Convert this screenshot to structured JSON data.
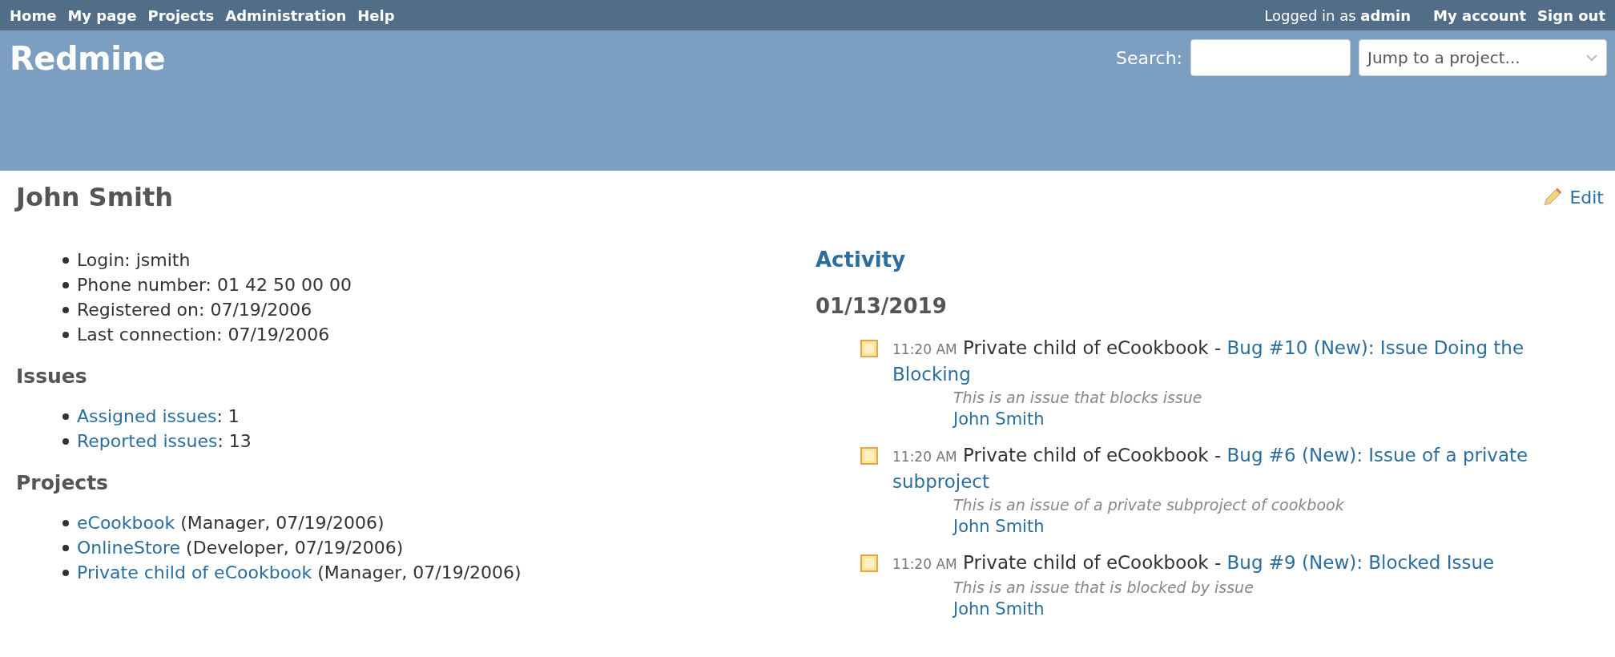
{
  "top_menu": {
    "items": [
      "Home",
      "My page",
      "Projects",
      "Administration",
      "Help"
    ],
    "logged_in": "Logged in as **admin**",
    "account_links": [
      "My account",
      "Sign out"
    ]
  },
  "header": {
    "title": "Redmine",
    "search_label": "Search:",
    "project_jump": {
      "placeholder": "Jump to a project..."
    }
  },
  "user": {
    "name": "John Smith",
    "edit_label": "Edit",
    "details": [
      "Login: jsmith",
      "Phone number: 01 42 50 00 00",
      "Registered on: 07/19/2006",
      "Last connection: 07/19/2006"
    ]
  },
  "issues": {
    "heading": "Issues",
    "items": [
      {
        "link": "Assigned issues",
        "rest": ": 1"
      },
      {
        "link": "Reported issues",
        "rest": ": 13"
      }
    ]
  },
  "projects": {
    "heading": "Projects",
    "items": [
      {
        "link": "eCookbook",
        "rest": " (Manager, 07/19/2006)"
      },
      {
        "link": "OnlineStore",
        "rest": " (Developer, 07/19/2006)"
      },
      {
        "link": "Private child of eCookbook",
        "rest": " (Manager, 07/19/2006)"
      }
    ]
  },
  "activity": {
    "heading": "Activity",
    "date": "01/13/2019",
    "entries": [
      {
        "time": "11:20 AM",
        "project": "Private child of eCookbook -",
        "link": [
          "Bug #10 (New): Issue Doing the",
          "Blocking"
        ],
        "description": "This is an issue that blocks issue",
        "author": "John Smith"
      },
      {
        "time": "11:20 AM",
        "project": "Private child of eCookbook -",
        "link": [
          "Bug #6 (New): Issue of a private",
          "subproject"
        ],
        "description": "This is an issue of a private subproject of cookbook",
        "author": "John Smith"
      },
      {
        "time": "11:20 AM",
        "project": "Private child of eCookbook -",
        "link": [
          "Bug #9 (New): Blocked Issue"
        ],
        "description": "This is an issue that is blocked by issue",
        "author": "John Smith"
      }
    ]
  }
}
